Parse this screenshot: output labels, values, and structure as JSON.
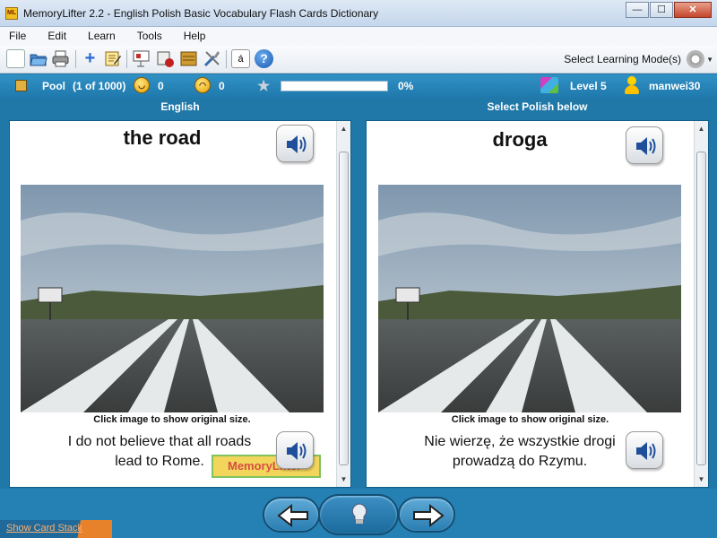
{
  "window": {
    "title": "MemoryLifter 2.2 - English Polish Basic Vocabulary Flash Cards Dictionary",
    "app_icon_text": "ML",
    "minimize": "—",
    "maximize": "☐",
    "close": "✕"
  },
  "menu": [
    "File",
    "Edit",
    "Learn",
    "Tools",
    "Help"
  ],
  "toolbar": {
    "icons": [
      "new-document-icon",
      "open-folder-icon",
      "print-icon",
      "add-card-icon",
      "edit-notepad-icon",
      "presentation-icon",
      "gallery-icon",
      "cardbox-icon",
      "tools-icon",
      "special-character-icon",
      "help-icon"
    ],
    "mode_label": "Select Learning Mode(s)"
  },
  "status": {
    "pool_label": "Pool",
    "pool_count": "(1 of 1000)",
    "correct_count": "0",
    "wrong_count": "0",
    "progress_percent": 0,
    "progress_text": "0%",
    "level": "Level 5",
    "username": "manwei30"
  },
  "question": {
    "header": "English",
    "word": "the road",
    "caption": "Click image to show original size.",
    "sentence": "I do not believe that all roads lead to Rome.",
    "watermark": "MemoryLifter"
  },
  "answer": {
    "header": "Select Polish below",
    "word": "droga",
    "caption": "Click image to show original size.",
    "sentence": "Nie wierzę, że wszystkie drogi prowadzą do Rzymu."
  },
  "footer": {
    "show_card_stack": "Show Card Stack"
  },
  "colors": {
    "accent": "#1f78a8",
    "status_bar": "#2a86ba",
    "watermark_text": "#d03020"
  }
}
